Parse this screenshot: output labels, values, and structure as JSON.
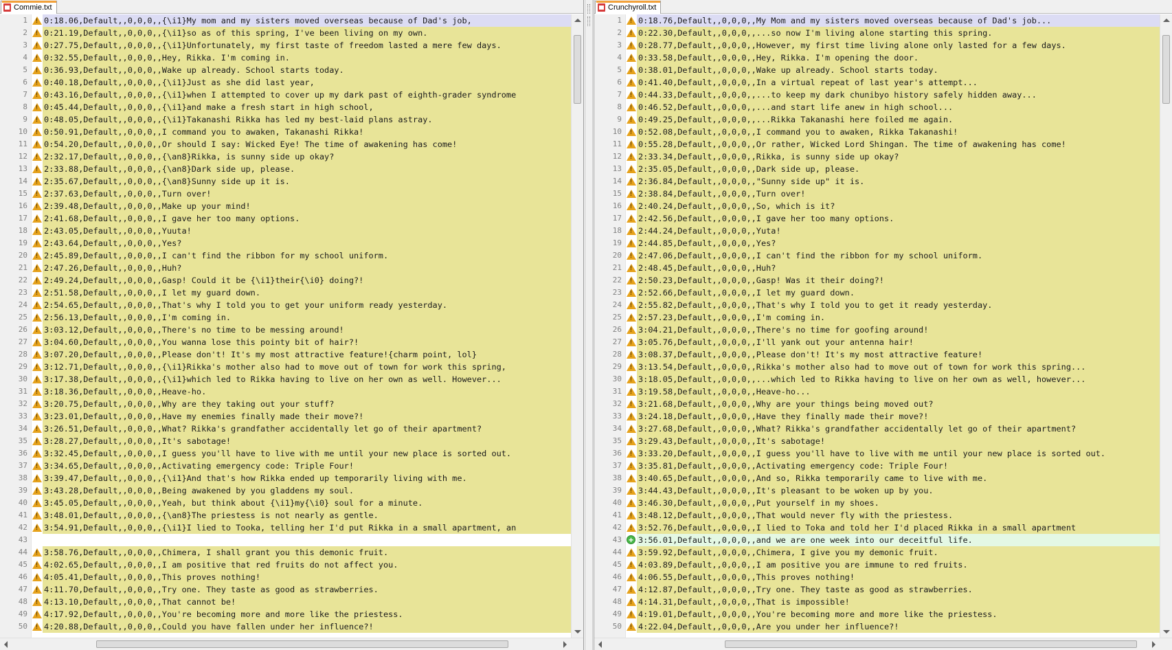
{
  "left": {
    "tab": "Commie.txt",
    "lines": [
      "0:18.06,Default,,0,0,0,,{\\i1}My mom and my sisters moved overseas because of Dad's job,",
      "0:21.19,Default,,0,0,0,,{\\i1}so as of this spring, I've been living on my own.",
      "0:27.75,Default,,0,0,0,,{\\i1}Unfortunately, my first taste of freedom lasted a mere few days.",
      "0:32.55,Default,,0,0,0,,Hey, Rikka. I'm coming in.",
      "0:36.93,Default,,0,0,0,,Wake up already. School starts today.",
      "0:40.18,Default,,0,0,0,,{\\i1}Just as she did last year,",
      "0:43.16,Default,,0,0,0,,{\\i1}when I attempted to cover up my dark past of eighth-grader syndrome",
      "0:45.44,Default,,0,0,0,,{\\i1}and make a fresh start in high school,",
      "0:48.05,Default,,0,0,0,,{\\i1}Takanashi Rikka has led my best-laid plans astray.",
      "0:50.91,Default,,0,0,0,,I command you to awaken, Takanashi Rikka!",
      "0:54.20,Default,,0,0,0,,Or should I say: Wicked Eye! The time of awakening has come!",
      "2:32.17,Default,,0,0,0,,{\\an8}Rikka, is sunny side up okay?",
      "2:33.88,Default,,0,0,0,,{\\an8}Dark side up, please.",
      "2:35.67,Default,,0,0,0,,{\\an8}Sunny side up it is.",
      "2:37.63,Default,,0,0,0,,Turn over!",
      "2:39.48,Default,,0,0,0,,Make up your mind!",
      "2:41.68,Default,,0,0,0,,I gave her too many options.",
      "2:43.05,Default,,0,0,0,,Yuuta!",
      "2:43.64,Default,,0,0,0,,Yes?",
      "2:45.89,Default,,0,0,0,,I can't find the ribbon for my school uniform.",
      "2:47.26,Default,,0,0,0,,Huh?",
      "2:49.24,Default,,0,0,0,,Gasp! Could it be {\\i1}their{\\i0} doing?!",
      "2:51.58,Default,,0,0,0,,I let my guard down.",
      "2:54.65,Default,,0,0,0,,That's why I told you to get your uniform ready yesterday.",
      "2:56.13,Default,,0,0,0,,I'm coming in.",
      "3:03.12,Default,,0,0,0,,There's no time to be messing around!",
      "3:04.60,Default,,0,0,0,,You wanna lose this pointy bit of hair?!",
      "3:07.20,Default,,0,0,0,,Please don't! It's my most attractive feature!{charm point, lol}",
      "3:12.71,Default,,0,0,0,,{\\i1}Rikka's mother also had to move out of town for work this spring,",
      "3:17.38,Default,,0,0,0,,{\\i1}which led to Rikka having to live on her own as well. However...",
      "3:18.36,Default,,0,0,0,,Heave-ho.",
      "3:20.75,Default,,0,0,0,,Why are they taking out your stuff?",
      "3:23.01,Default,,0,0,0,,Have my enemies finally made their move?!",
      "3:26.51,Default,,0,0,0,,What? Rikka's grandfather accidentally let go of their apartment?",
      "3:28.27,Default,,0,0,0,,It's sabotage!",
      "3:32.45,Default,,0,0,0,,I guess you'll have to live with me until your new place is sorted out.",
      "3:34.65,Default,,0,0,0,,Activating emergency code: Triple Four!",
      "3:39.47,Default,,0,0,0,,{\\i1}And that's how Rikka ended up temporarily living with me.",
      "3:43.28,Default,,0,0,0,,Being awakened by you gladdens my soul.",
      "3:45.05,Default,,0,0,0,,Yeah, but think about {\\i1}my{\\i0} soul for a minute.",
      "3:48.01,Default,,0,0,0,,{\\an8}The priestess is not nearly as gentle.",
      "3:54.91,Default,,0,0,0,,{\\i1}I lied to Tooka, telling her I'd put Rikka in a small apartment, an",
      "",
      "3:58.76,Default,,0,0,0,,Chimera, I shall grant you this demonic fruit.",
      "4:02.65,Default,,0,0,0,,I am positive that red fruits do not affect you.",
      "4:05.41,Default,,0,0,0,,This proves nothing!",
      "4:11.70,Default,,0,0,0,,Try one. They taste as good as strawberries.",
      "4:13.10,Default,,0,0,0,,That cannot be!",
      "4:17.92,Default,,0,0,0,,You're becoming more and more like the priestess.",
      "4:20.88,Default,,0,0,0,,Could you have fallen under her influence?!"
    ]
  },
  "right": {
    "tab": "Crunchyroll.txt",
    "lines": [
      "0:18.76,Default,,0,0,0,,My Mom and my sisters moved overseas because of Dad's job...",
      "0:22.30,Default,,0,0,0,,...so now I'm living alone starting this spring.",
      "0:28.77,Default,,0,0,0,,However, my first time living alone only lasted for a few days.",
      "0:33.58,Default,,0,0,0,,Hey, Rikka. I'm opening the door.",
      "0:38.01,Default,,0,0,0,,Wake up already. School starts today.",
      "0:41.40,Default,,0,0,0,,In a virtual repeat of last year's attempt...",
      "0:44.33,Default,,0,0,0,,...to keep my dark chunibyo history safely hidden away...",
      "0:46.52,Default,,0,0,0,,...and start life anew in high school...",
      "0:49.25,Default,,0,0,0,,...Rikka Takanashi here foiled me again.",
      "0:52.08,Default,,0,0,0,,I command you to awaken, Rikka Takanashi!",
      "0:55.28,Default,,0,0,0,,Or rather, Wicked Lord Shingan. The time of awakening has come!",
      "2:33.34,Default,,0,0,0,,Rikka, is sunny side up okay?",
      "2:35.05,Default,,0,0,0,,Dark side up, please.",
      "2:36.84,Default,,0,0,0,,\"Sunny side up\" it is.",
      "2:38.84,Default,,0,0,0,,Turn over!",
      "2:40.24,Default,,0,0,0,,So, which is it?",
      "2:42.56,Default,,0,0,0,,I gave her too many options.",
      "2:44.24,Default,,0,0,0,,Yuta!",
      "2:44.85,Default,,0,0,0,,Yes?",
      "2:47.06,Default,,0,0,0,,I can't find the ribbon for my school uniform.",
      "2:48.45,Default,,0,0,0,,Huh?",
      "2:50.23,Default,,0,0,0,,Gasp! Was it their doing?!",
      "2:52.66,Default,,0,0,0,,I let my guard down.",
      "2:55.82,Default,,0,0,0,,That's why I told you to get it ready yesterday.",
      "2:57.23,Default,,0,0,0,,I'm coming in.",
      "3:04.21,Default,,0,0,0,,There's no time for goofing around!",
      "3:05.76,Default,,0,0,0,,I'll yank out your antenna hair!",
      "3:08.37,Default,,0,0,0,,Please don't! It's my most attractive feature!",
      "3:13.54,Default,,0,0,0,,Rikka's mother also had to move out of town for work this spring...",
      "3:18.05,Default,,0,0,0,,...which led to Rikka having to live on her own as well, however...",
      "3:19.58,Default,,0,0,0,,Heave-ho...",
      "3:21.68,Default,,0,0,0,,Why are your things being moved out?",
      "3:24.18,Default,,0,0,0,,Have they finally made their move?!",
      "3:27.68,Default,,0,0,0,,What? Rikka's grandfather accidentally let go of their apartment?",
      "3:29.43,Default,,0,0,0,,It's sabotage!",
      "3:33.20,Default,,0,0,0,,I guess you'll have to live with me until your new place is sorted out.",
      "3:35.81,Default,,0,0,0,,Activating emergency code: Triple Four!",
      "3:40.65,Default,,0,0,0,,And so, Rikka temporarily came to live with me.",
      "3:44.43,Default,,0,0,0,,It's pleasant to be woken up by you.",
      "3:46.30,Default,,0,0,0,,Put yourself in my shoes.",
      "3:48.12,Default,,0,0,0,,That would never fly with the priestess.",
      "3:52.76,Default,,0,0,0,,I lied to Toka and told her I'd placed Rikka in a small apartment",
      "3:56.01,Default,,0,0,0,,and we are one week into our deceitful life.",
      "3:59.92,Default,,0,0,0,,Chimera, I give you my demonic fruit.",
      "4:03.89,Default,,0,0,0,,I am positive you are immune to red fruits.",
      "4:06.55,Default,,0,0,0,,This proves nothing!",
      "4:12.87,Default,,0,0,0,,Try one. They taste as good as strawberries.",
      "4:14.31,Default,,0,0,0,,That is impossible!",
      "4:19.01,Default,,0,0,0,,You're becoming more and more like the priestess.",
      "4:22.04,Default,,0,0,0,,Are you under her influence?!"
    ]
  },
  "colors": {
    "changed_line": "#e8e498",
    "added_line": "#e4f8e4",
    "current_line": "#dcdcf4",
    "empty_line": "#ebebeb",
    "warning_marker": "#e6a21b",
    "added_marker": "#48b848"
  },
  "markers": {
    "changed": "warning-icon",
    "added": "plus-circle-icon"
  }
}
